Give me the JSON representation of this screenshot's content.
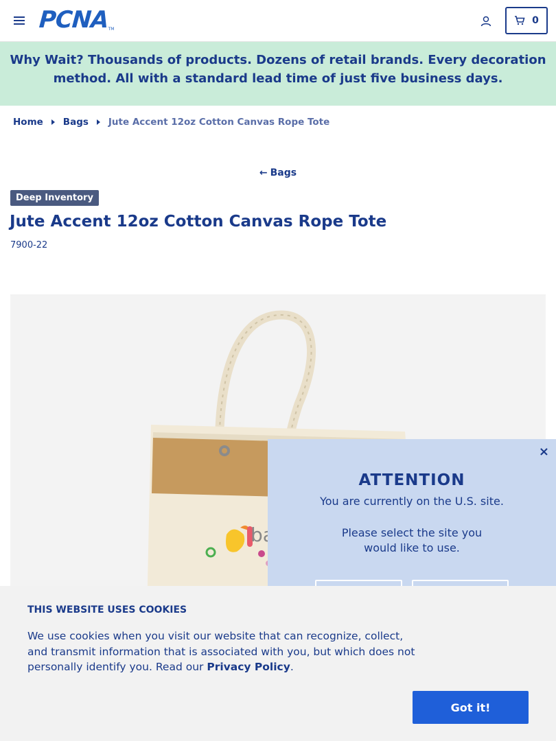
{
  "header": {
    "logo_text": "PCNA",
    "logo_tm": "TM",
    "cart_count": "0"
  },
  "promo": {
    "text": "Why Wait? Thousands of products. Dozens of retail brands. Every decoration method. All with a standard lead time of just five business days."
  },
  "breadcrumb": {
    "home": "Home",
    "category": "Bags",
    "current": "Jute Accent 12oz Cotton Canvas Rope Tote"
  },
  "back_link": {
    "arrow": "←",
    "label": "Bags"
  },
  "product": {
    "badge": "Deep Inventory",
    "title": "Jute Accent 12oz Cotton Canvas Rope Tote",
    "sku": "7900-22"
  },
  "attention": {
    "close": "×",
    "title": "ATTENTION",
    "line1": "You are currently on the U.S. site.",
    "line2": "Please select the site you would like to use."
  },
  "cookie": {
    "title": "THIS WEBSITE USES COOKIES",
    "text": "We use cookies when you visit our website that can recognize, collect, and transmit information that is associated with you, but which does not personally identify you. Read our ",
    "link": "Privacy Policy",
    "period": ".",
    "button": "Got it!"
  },
  "icons": {
    "menu": "menu-icon",
    "user": "user-icon",
    "cart": "cart-icon",
    "breadcrumb_separator": "caret-right-icon"
  },
  "colors": {
    "brand_blue": "#1a3a8a",
    "logo_blue": "#1f5fbf",
    "promo_bg": "#c9ecd9",
    "badge_bg": "#4a5a80",
    "attention_bg": "#c9d8f0",
    "cookie_bg": "#f2f2f2",
    "button_blue": "#1f5fd9"
  }
}
